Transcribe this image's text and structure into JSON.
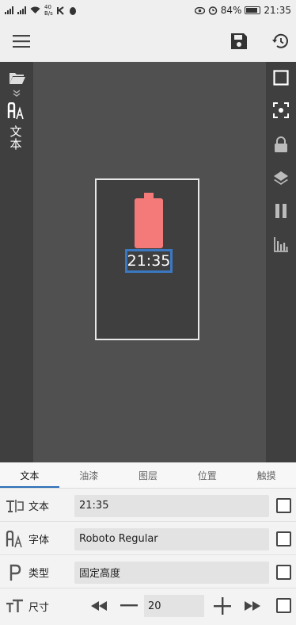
{
  "status_bar": {
    "speed_value": "40",
    "speed_unit": "B/s",
    "battery_percent": "84%",
    "time": "21:35"
  },
  "canvas": {
    "clock_text": "21:35",
    "vertical_label": "文本",
    "battery_widget_color": "#f47a7a"
  },
  "tabs": [
    {
      "label": "文本",
      "active": true
    },
    {
      "label": "油漆",
      "active": false
    },
    {
      "label": "图层",
      "active": false
    },
    {
      "label": "位置",
      "active": false
    },
    {
      "label": "触摸",
      "active": false
    }
  ],
  "properties": {
    "text": {
      "label": "文本",
      "value": "21:35"
    },
    "font": {
      "label": "字体",
      "value": "Roboto Regular"
    },
    "type": {
      "label": "类型",
      "value": "固定高度"
    },
    "size": {
      "label": "尺寸",
      "value": "20"
    }
  },
  "colors": {
    "accent": "#2e6fb8",
    "selection": "#3b78c2",
    "workspace": "#505050"
  }
}
